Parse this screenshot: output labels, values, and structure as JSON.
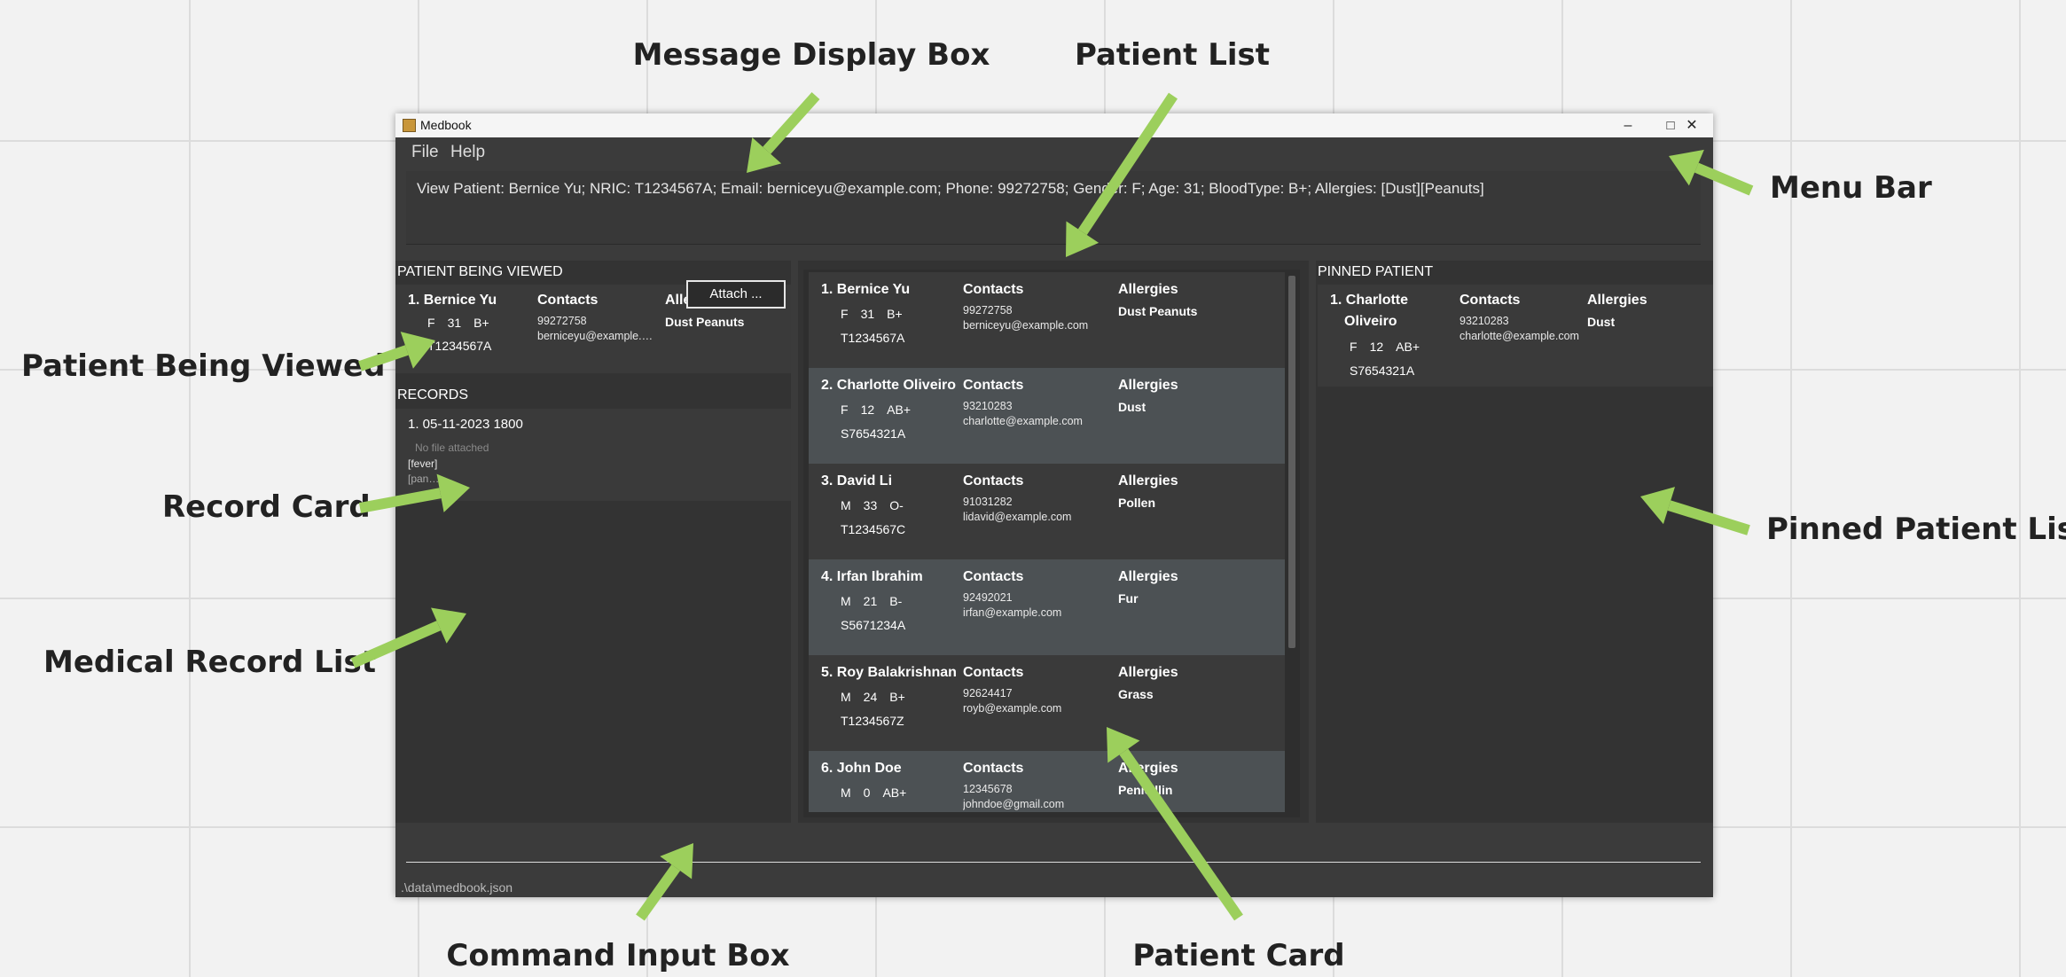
{
  "annotations": {
    "message_display_box": "Message Display Box",
    "patient_list": "Patient List",
    "menu_bar": "Menu Bar",
    "patient_being_viewed": "Patient Being Viewed",
    "record_card": "Record Card",
    "pinned_patient_list": "Pinned Patient List",
    "medical_record_list": "Medical Record List",
    "command_input_box": "Command Input Box",
    "patient_card": "Patient Card",
    "arrow_color": "#9ccf5c"
  },
  "window": {
    "title": "Medbook",
    "minimize": "–",
    "maximize": "□",
    "close": "✕"
  },
  "menu": {
    "file": "File",
    "help": "Help"
  },
  "result_message": "View Patient: Bernice Yu; NRIC: T1234567A; Email: berniceyu@example.com; Phone: 99272758; Gender: F; Age: 31; BloodType: B+; Allergies: [Dust][Peanuts]",
  "viewed": {
    "title": "PATIENT BEING VIEWED",
    "name": "1. Bernice Yu",
    "gender": "F",
    "age": "31",
    "blood": "B+",
    "nric": "T1234567A",
    "contacts_label": "Contacts",
    "phone": "99272758",
    "email": "berniceyu@example.com",
    "allergies_label": "Allergies",
    "allergies": "Dust Peanuts"
  },
  "records": {
    "title": "RECORDS",
    "item": "1. 05-11-2023 1800",
    "file_status": "No file attached",
    "line1": "[fever]",
    "line2": "[panadol]",
    "attach_label": "Attach ..."
  },
  "patients": [
    {
      "name": "1. Bernice Yu",
      "gender": "F",
      "age": "31",
      "blood": "B+",
      "nric": "T1234567A",
      "contacts_label": "Contacts",
      "phone": "99272758",
      "email": "berniceyu@example.com",
      "allergies_label": "Allergies",
      "allergies": "Dust Peanuts"
    },
    {
      "name": "2. Charlotte Oliveiro",
      "gender": "F",
      "age": "12",
      "blood": "AB+",
      "nric": "S7654321A",
      "contacts_label": "Contacts",
      "phone": "93210283",
      "email": "charlotte@example.com",
      "allergies_label": "Allergies",
      "allergies": "Dust"
    },
    {
      "name": "3. David Li",
      "gender": "M",
      "age": "33",
      "blood": "O-",
      "nric": "T1234567C",
      "contacts_label": "Contacts",
      "phone": "91031282",
      "email": "lidavid@example.com",
      "allergies_label": "Allergies",
      "allergies": "Pollen"
    },
    {
      "name": "4. Irfan Ibrahim",
      "gender": "M",
      "age": "21",
      "blood": "B-",
      "nric": "S5671234A",
      "contacts_label": "Contacts",
      "phone": "92492021",
      "email": "irfan@example.com",
      "allergies_label": "Allergies",
      "allergies": "Fur"
    },
    {
      "name": "5. Roy Balakrishnan",
      "gender": "M",
      "age": "24",
      "blood": "B+",
      "nric": "T1234567Z",
      "contacts_label": "Contacts",
      "phone": "92624417",
      "email": "royb@example.com",
      "allergies_label": "Allergies",
      "allergies": "Grass"
    },
    {
      "name": "6. John Doe",
      "gender": "M",
      "age": "0",
      "blood": "AB+",
      "nric": "",
      "contacts_label": "Contacts",
      "phone": "12345678",
      "email": "johndoe@gmail.com",
      "allergies_label": "Allergies",
      "allergies": "Penicillin"
    }
  ],
  "pinned": {
    "title": "PINNED PATIENT",
    "name_line1": "1. Charlotte",
    "name_line2": "Oliveiro",
    "gender": "F",
    "age": "12",
    "blood": "AB+",
    "nric": "S7654321A",
    "contacts_label": "Contacts",
    "phone": "93210283",
    "email": "charlotte@example.com",
    "allergies_label": "Allergies",
    "allergies": "Dust"
  },
  "status": {
    "path": ".\\data\\medbook.json"
  }
}
